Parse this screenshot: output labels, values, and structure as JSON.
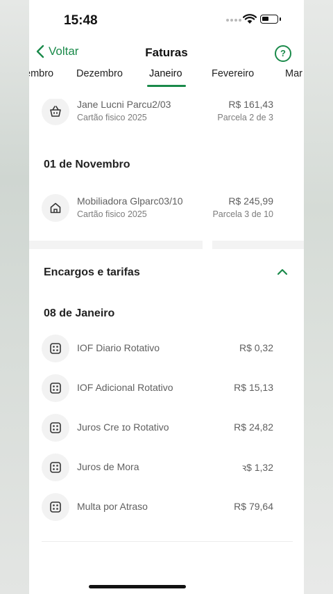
{
  "status": {
    "time": "15:48"
  },
  "nav": {
    "back_label": "Voltar",
    "title": "Faturas",
    "help_label": "?"
  },
  "tabs": [
    "embro",
    "Dezembro",
    "Janeiro",
    "Fevereiro",
    "Mar"
  ],
  "active_tab": "Janeiro",
  "top_item": {
    "name": "Jane Lucni Parcu2/03",
    "card": "Cartão fisico 2025",
    "amount": "R$ 161,43",
    "installment": "Parcela 2 de 3",
    "icon": "basket-icon"
  },
  "date_nov": "01 de Novembro",
  "nov_item": {
    "name": "Mobiliadora Glparc03/10",
    "card": "Cartão fisico 2025",
    "amount": "R$ 245,99",
    "installment": "Parcela 3 de 10",
    "icon": "home-icon"
  },
  "charges": {
    "title": "Encargos e tarifas",
    "date": "08 de Janeiro",
    "items": [
      {
        "name": "IOF Diario Rotativo",
        "amount": "R$ 0,32"
      },
      {
        "name": "IOF Adicional Rotativo",
        "amount": "R$ 15,13"
      },
      {
        "name": "Juros Cre  ɪo Rotativo",
        "amount": "R$ 24,82"
      },
      {
        "name": "Juros de Mora",
        "amount": "ꝛ$ 1,32"
      },
      {
        "name": "Multa por Atraso",
        "amount": "R$ 79,64"
      }
    ]
  },
  "colors": {
    "accent": "#1a8a4a",
    "text": "#222222",
    "muted": "#7c7c7c"
  }
}
